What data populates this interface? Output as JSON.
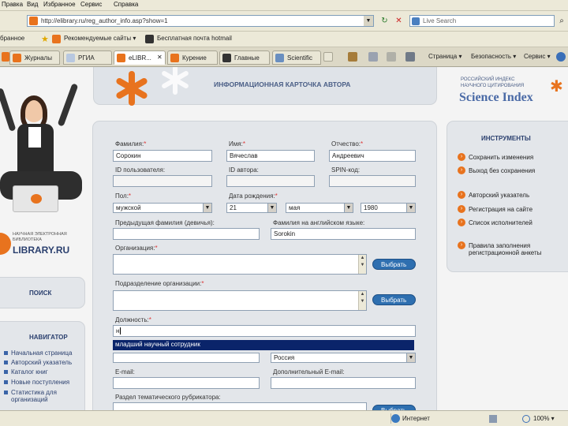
{
  "browser": {
    "menu": [
      "Правка",
      "Вид",
      "Избранное",
      "Сервис",
      "Справка"
    ],
    "address": "http://elibrary.ru/reg_author_info.asp?show=1",
    "search_placeholder": "Live Search",
    "fav_label": "бранное",
    "fav_items": [
      "Рекомендуемые сайты ▾",
      "Бесплатная почта hotmail"
    ],
    "tabs": [
      "Журналы",
      "РГИА",
      "eLIBR...",
      "Курение",
      "Главные",
      "Scientific"
    ],
    "tools": [
      "Страница ▾",
      "Безопасность ▾",
      "Сервис ▾"
    ],
    "status_zone": "Интернет",
    "status_zoom": "100% ▾"
  },
  "site": {
    "header_title": "ИНФОРМАЦИОННАЯ КАРТОЧКА АВТОРА",
    "si_top": "РОССИЙСКИЙ ИНДЕКС\nНАУЧНОГО ЦИТИРОВАНИЯ",
    "si_name": "Science Index",
    "logo_small": "НАУЧНАЯ ЭЛЕКТРОННАЯ\nБИБЛИОТЕКА",
    "logo_main": "LIBRARY.RU",
    "search_label": "ПОИСК",
    "nav_title": "НАВИГАТОР",
    "nav_items": [
      "Начальная страница",
      "Авторский указатель",
      "Каталог книг",
      "Новые поступления",
      "Статистика для организаций"
    ]
  },
  "form": {
    "surname_label": "Фамилия:",
    "surname": "Сорокин",
    "name_label": "Имя:",
    "name": "Вячеслав",
    "patronymic_label": "Отчество:",
    "patronymic": "Андреевич",
    "userid_label": "ID пользователя:",
    "authorid_label": "ID автора:",
    "spin_label": "SPIN-код:",
    "gender_label": "Пол:",
    "gender": "мужской",
    "dob_label": "Дата рождения:",
    "dob_day": "21",
    "dob_month": "мая",
    "dob_year": "1980",
    "prev_surname_label": "Предыдущая фамилия (девичья):",
    "eng_surname_label": "Фамилия на английском языке:",
    "eng_surname": "Sorokin",
    "org_label": "Организация:",
    "dept_label": "Подразделение организации:",
    "position_label": "Должность:",
    "position": "н",
    "suggestion": "младший научный сотрудник",
    "country": "Россия",
    "email_label": "E-mail:",
    "email2_label": "Дополнительный E-mail:",
    "rubric_label": "Раздел тематического рубрикатора:",
    "choose_btn": "Выбрать"
  },
  "tools_panel": {
    "title": "ИНСТРУМЕНТЫ",
    "items": [
      "Сохранить изменения",
      "Выход без сохранения",
      "Авторский указатель",
      "Регистрация на сайте",
      "Список исполнителей",
      "Правила заполнения регистрационной анкеты"
    ]
  },
  "colors": {
    "accent": "#e8731e",
    "brand": "#2a3f6e",
    "button": "#2e6fb0",
    "highlight": "#0a246a"
  }
}
